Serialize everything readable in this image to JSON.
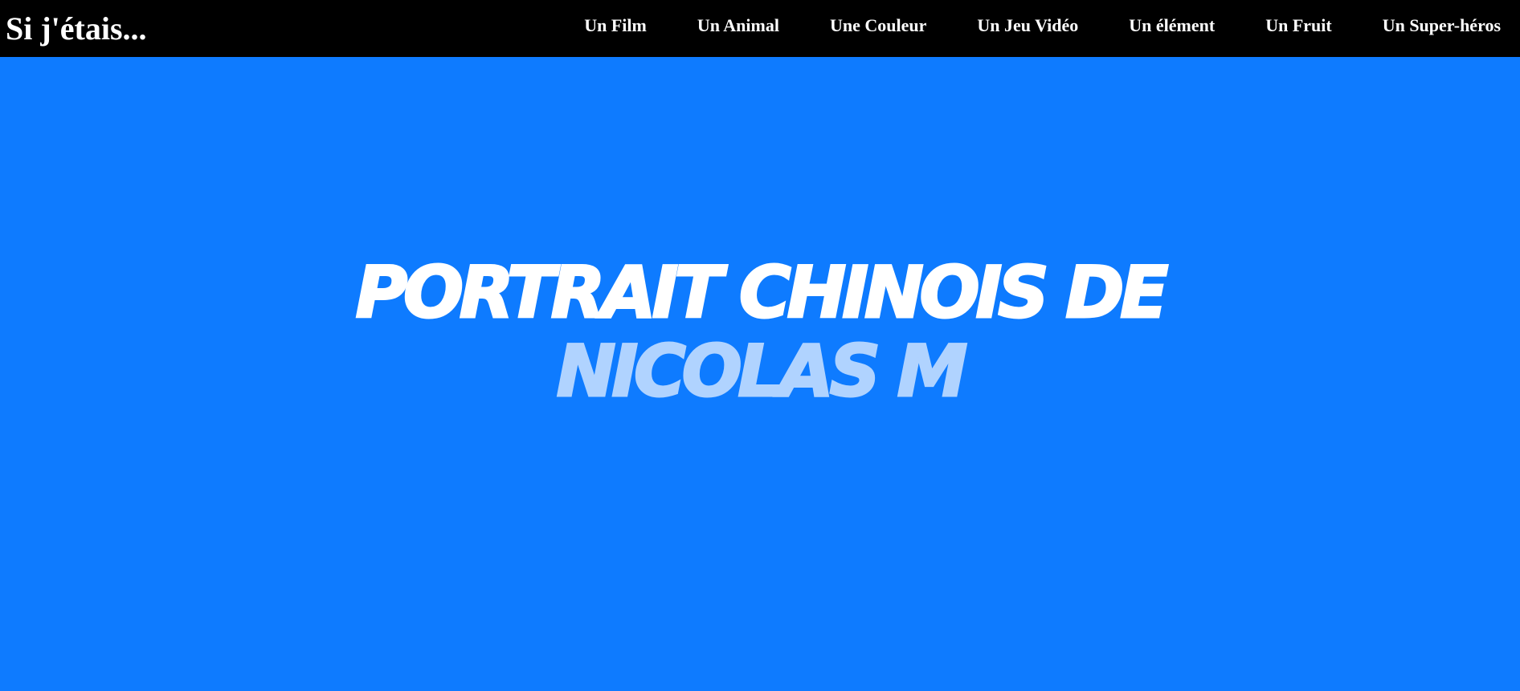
{
  "nav": {
    "brand": "Si j'étais...",
    "links": [
      "Un Film",
      "Un Animal",
      "Une Couleur",
      "Un Jeu Vidéo",
      "Un élément",
      "Un Fruit",
      "Un Super-héros"
    ]
  },
  "hero": {
    "title_line1": "PORTRAIT CHINOIS DE",
    "title_line2": "NICOLAS M"
  },
  "colors": {
    "navbar_bg": "#000000",
    "page_bg": "#0e7bff",
    "title_text": "#ffffff",
    "name_text": "#b0d3ff"
  }
}
